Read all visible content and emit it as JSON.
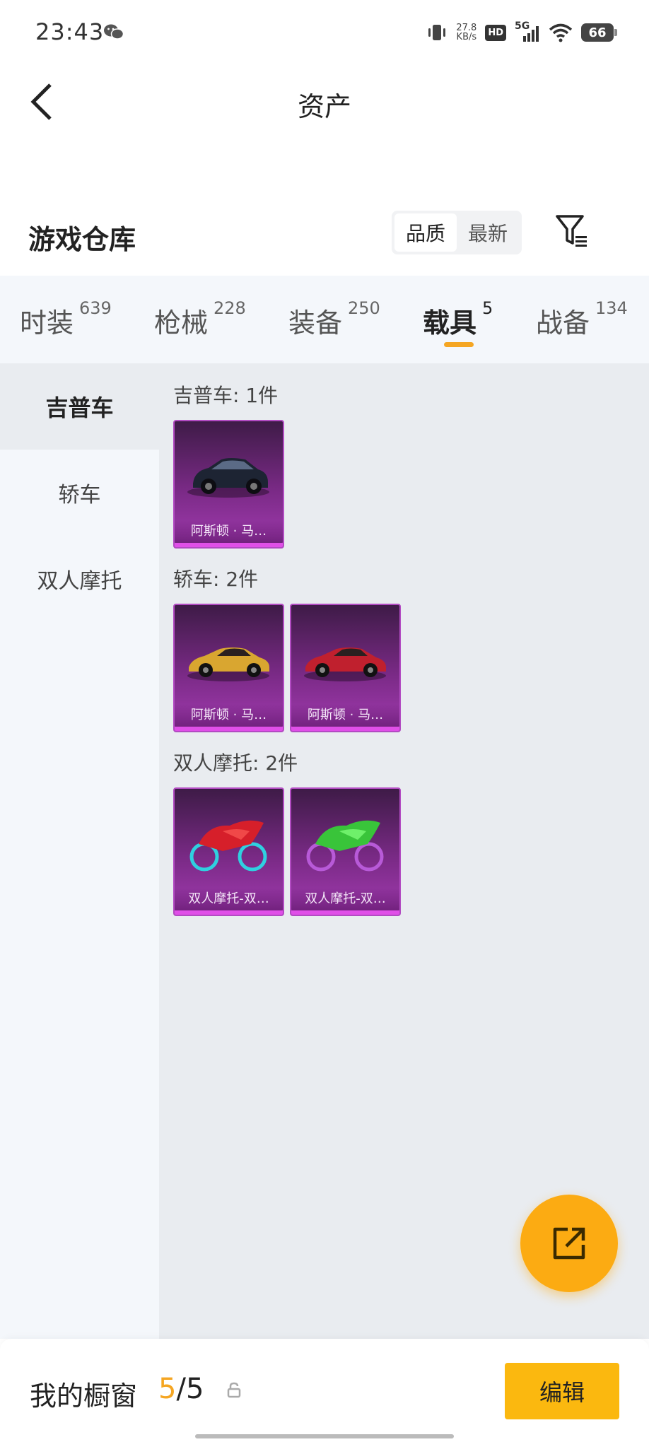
{
  "status_bar": {
    "time": "23:43",
    "speed_value": "27.8",
    "speed_unit": "KB/s",
    "hd": "HD",
    "network": "5G",
    "battery": "66",
    "icons": [
      "wechat-icon",
      "vibrate-icon",
      "signal-icon",
      "wifi-icon",
      "battery-icon"
    ]
  },
  "header": {
    "title": "资产",
    "back_icon": "back-arrow-icon"
  },
  "warehouse": {
    "title": "游戏仓库",
    "sort_options": [
      "品质",
      "最新"
    ],
    "sort_selected": "品质",
    "filter_icon": "filter-icon"
  },
  "tabs": [
    {
      "label": "时装",
      "count": "639"
    },
    {
      "label": "枪械",
      "count": "228"
    },
    {
      "label": "装备",
      "count": "250"
    },
    {
      "label": "载具",
      "count": "5",
      "active": true
    },
    {
      "label": "战备",
      "count": "134"
    }
  ],
  "side_nav": [
    {
      "label": "吉普车",
      "active": true
    },
    {
      "label": "轿车"
    },
    {
      "label": "双人摩托"
    }
  ],
  "sections": [
    {
      "title": "吉普车: 1件",
      "items": [
        {
          "label": "阿斯顿 · 马…",
          "art": "suv-dark"
        }
      ]
    },
    {
      "title": "轿车: 2件",
      "items": [
        {
          "label": "阿斯顿 · 马…",
          "art": "car-gold"
        },
        {
          "label": "阿斯顿 · 马…",
          "art": "car-red"
        }
      ]
    },
    {
      "title": "双人摩托: 2件",
      "items": [
        {
          "label": "双人摩托-双…",
          "art": "moto-red"
        },
        {
          "label": "双人摩托-双…",
          "art": "moto-green"
        }
      ]
    }
  ],
  "colors": {
    "accent": "#f5a623",
    "card_purple": "#7a2a86",
    "fab": "#fcab12",
    "edit_button": "#fbb80f"
  },
  "share_fab_icon": "share-icon",
  "bottom_bar": {
    "label": "我的橱窗",
    "current": "5",
    "separator": "/",
    "total": "5",
    "lock_icon": "lock-icon",
    "edit_label": "编辑"
  }
}
